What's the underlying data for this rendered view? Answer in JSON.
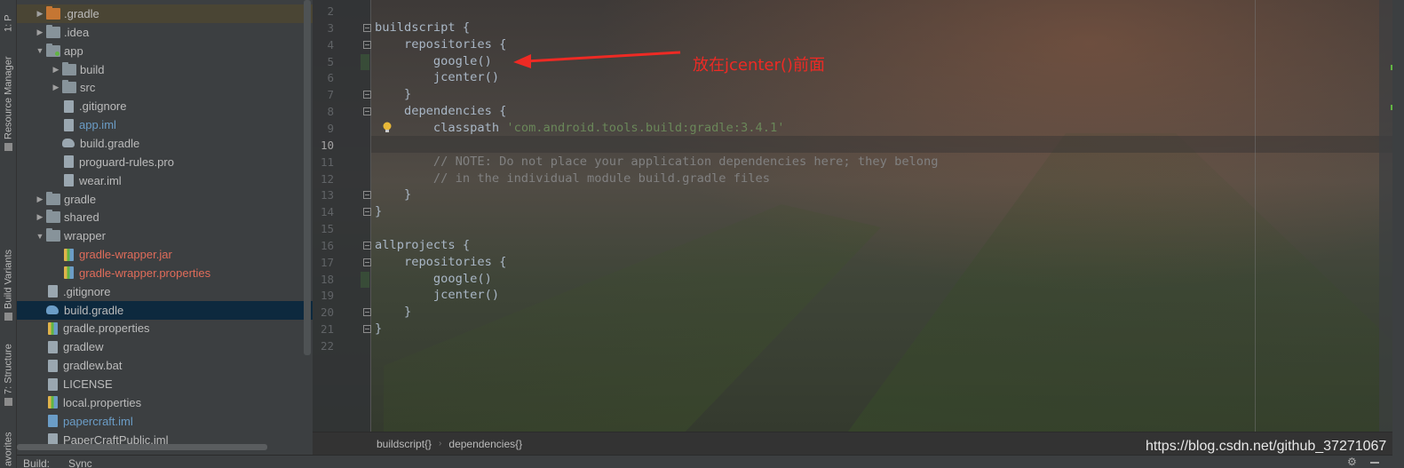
{
  "toolstrip": {
    "project_label": "1: P",
    "resource_manager": "Resource Manager",
    "build_variants": "Build Variants",
    "structure": "7: Structure",
    "favorites": "avorites"
  },
  "tree": [
    {
      "label": ".gradle",
      "indent": 1,
      "arrow": "▶",
      "icon": "folder-orange",
      "highlight": true
    },
    {
      "label": ".idea",
      "indent": 1,
      "arrow": "▶",
      "icon": "folder"
    },
    {
      "label": "app",
      "indent": 1,
      "arrow": "▼",
      "icon": "folder-green-dot"
    },
    {
      "label": "build",
      "indent": 2,
      "arrow": "▶",
      "icon": "folder"
    },
    {
      "label": "src",
      "indent": 2,
      "arrow": "▶",
      "icon": "folder"
    },
    {
      "label": ".gitignore",
      "indent": 2,
      "arrow": "",
      "icon": "file"
    },
    {
      "label": "app.iml",
      "indent": 2,
      "arrow": "",
      "icon": "file",
      "color": "blue"
    },
    {
      "label": "build.gradle",
      "indent": 2,
      "arrow": "",
      "icon": "gradle"
    },
    {
      "label": "proguard-rules.pro",
      "indent": 2,
      "arrow": "",
      "icon": "file"
    },
    {
      "label": "wear.iml",
      "indent": 2,
      "arrow": "",
      "icon": "file"
    },
    {
      "label": "gradle",
      "indent": 1,
      "arrow": "▶",
      "icon": "folder"
    },
    {
      "label": "shared",
      "indent": 1,
      "arrow": "▶",
      "icon": "folder"
    },
    {
      "label": "wrapper",
      "indent": 1,
      "arrow": "▼",
      "icon": "folder"
    },
    {
      "label": "gradle-wrapper.jar",
      "indent": 2,
      "arrow": "",
      "icon": "file-bars",
      "color": "red"
    },
    {
      "label": "gradle-wrapper.properties",
      "indent": 2,
      "arrow": "",
      "icon": "file-bars",
      "color": "red"
    },
    {
      "label": ".gitignore",
      "indent": 1,
      "arrow": "",
      "icon": "file"
    },
    {
      "label": "build.gradle",
      "indent": 1,
      "arrow": "",
      "icon": "gradle-blue",
      "selected": true
    },
    {
      "label": "gradle.properties",
      "indent": 1,
      "arrow": "",
      "icon": "file-bars"
    },
    {
      "label": "gradlew",
      "indent": 1,
      "arrow": "",
      "icon": "file"
    },
    {
      "label": "gradlew.bat",
      "indent": 1,
      "arrow": "",
      "icon": "file"
    },
    {
      "label": "LICENSE",
      "indent": 1,
      "arrow": "",
      "icon": "file"
    },
    {
      "label": "local.properties",
      "indent": 1,
      "arrow": "",
      "icon": "file-bars"
    },
    {
      "label": "papercraft.iml",
      "indent": 1,
      "arrow": "",
      "icon": "file-blue",
      "color": "blue"
    },
    {
      "label": "PaperCraftPublic.iml",
      "indent": 1,
      "arrow": "",
      "icon": "file"
    }
  ],
  "editor": {
    "current_line": 10,
    "lines": [
      {
        "n": "2",
        "segs": []
      },
      {
        "n": "3",
        "segs": [
          {
            "t": "buildscript {",
            "c": ""
          }
        ]
      },
      {
        "n": "4",
        "segs": [
          {
            "t": "    repositories {",
            "c": ""
          }
        ]
      },
      {
        "n": "5",
        "segs": [
          {
            "t": "        google()",
            "c": ""
          }
        ]
      },
      {
        "n": "6",
        "segs": [
          {
            "t": "        jcenter()",
            "c": ""
          }
        ]
      },
      {
        "n": "7",
        "segs": [
          {
            "t": "    }",
            "c": ""
          }
        ]
      },
      {
        "n": "8",
        "segs": [
          {
            "t": "    dependencies {",
            "c": ""
          }
        ]
      },
      {
        "n": "9",
        "segs": [
          {
            "t": "        classpath ",
            "c": ""
          },
          {
            "t": "'com.android.tools.build:gradle:3.4.1'",
            "c": "str"
          }
        ]
      },
      {
        "n": "10",
        "segs": []
      },
      {
        "n": "11",
        "segs": [
          {
            "t": "        // NOTE: Do not place your application dependencies here; they belong",
            "c": "cmt"
          }
        ]
      },
      {
        "n": "12",
        "segs": [
          {
            "t": "        // in the individual module build.gradle files",
            "c": "cmt"
          }
        ]
      },
      {
        "n": "13",
        "segs": [
          {
            "t": "    }",
            "c": ""
          }
        ]
      },
      {
        "n": "14",
        "segs": [
          {
            "t": "}",
            "c": ""
          }
        ]
      },
      {
        "n": "15",
        "segs": []
      },
      {
        "n": "16",
        "segs": [
          {
            "t": "allprojects {",
            "c": ""
          }
        ]
      },
      {
        "n": "17",
        "segs": [
          {
            "t": "    repositories {",
            "c": ""
          }
        ]
      },
      {
        "n": "18",
        "segs": [
          {
            "t": "        google()",
            "c": ""
          }
        ]
      },
      {
        "n": "19",
        "segs": [
          {
            "t": "        jcenter()",
            "c": ""
          }
        ]
      },
      {
        "n": "20",
        "segs": [
          {
            "t": "    }",
            "c": ""
          }
        ]
      },
      {
        "n": "21",
        "segs": [
          {
            "t": "}",
            "c": ""
          }
        ]
      },
      {
        "n": "22",
        "segs": []
      }
    ]
  },
  "annotation": {
    "text": "放在jcenter()前面",
    "color": "#ee2a24"
  },
  "breadcrumb": [
    "buildscript{}",
    "dependencies{}"
  ],
  "watermark": "https://blog.csdn.net/github_37271067",
  "bottombar": {
    "build_tab": "Build:",
    "sync_tab": "Sync"
  },
  "colors": {
    "accent_selection": "#0d293e",
    "string": "#6a8759",
    "comment": "#808080",
    "code": "#a9b7c6"
  },
  "icons": [
    "gradle-icon",
    "folder-icon",
    "file-icon",
    "lightbulb-icon",
    "gear-icon",
    "minimize-icon",
    "fold-icon"
  ]
}
